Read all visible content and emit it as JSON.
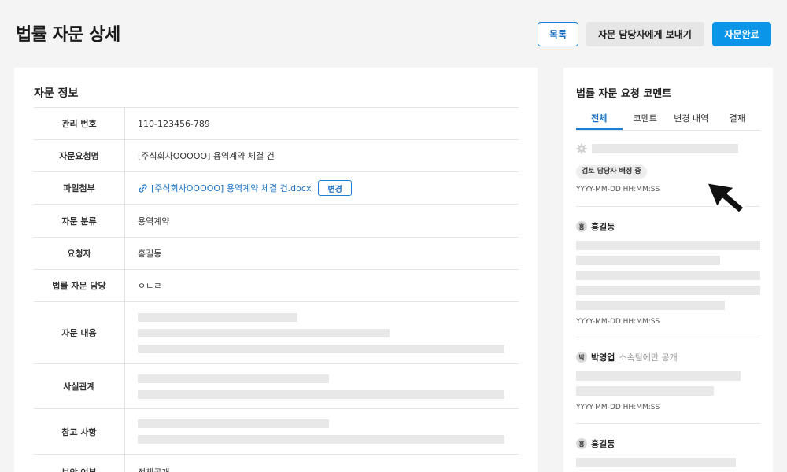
{
  "header": {
    "title": "법률 자문 상세",
    "buttons": {
      "list": "목록",
      "send": "자문 담당자에게 보내기",
      "done": "자문완료"
    }
  },
  "info": {
    "section_title": "자문 정보",
    "rows": {
      "mgmt_no": {
        "label": "관리 번호",
        "value": "110-123456-789"
      },
      "request_name": {
        "label": "자문요청명",
        "value": "[주식회사OOOOO] 용역계약 체결 건"
      },
      "attachment": {
        "label": "파일첨부",
        "value": "[주식회사OOOOO] 용역계약 체결 건.docx",
        "change_label": "변경"
      },
      "category": {
        "label": "자문 분류",
        "value": "용역계약"
      },
      "requester": {
        "label": "요청자",
        "value": "홍길동"
      },
      "assignee": {
        "label": "법률 자문 담당",
        "value": "ㅇㄴㄹ"
      },
      "content": {
        "label": "자문 내용"
      },
      "facts": {
        "label": "사실관계"
      },
      "notes": {
        "label": "참고 사항"
      },
      "security": {
        "label": "보안 여부",
        "value": "전체공개"
      }
    }
  },
  "comments_panel": {
    "title": "법률 자문 요청 코멘트",
    "tabs": [
      "전체",
      "코멘트",
      "변경 내역",
      "결재"
    ],
    "system": {
      "status": "검토 담당자 배정 중",
      "time": "YYYY-MM-DD HH:MM:SS"
    },
    "comment1": {
      "avatar": "홍",
      "author": "홍길동",
      "time": "YYYY-MM-DD HH:MM:SS"
    },
    "comment2": {
      "avatar": "박",
      "author": "박영업",
      "visibility": "소속팀에만 공개",
      "time": "YYYY-MM-DD HH:MM:SS"
    },
    "comment3": {
      "avatar": "홍",
      "author": "홍길동"
    }
  },
  "colors": {
    "primary": "#0a95e8",
    "link": "#1a73c8",
    "skeleton": "#e8e8e8"
  },
  "icons": [
    "link-icon",
    "gear-icon",
    "mouse-cursor-icon"
  ]
}
